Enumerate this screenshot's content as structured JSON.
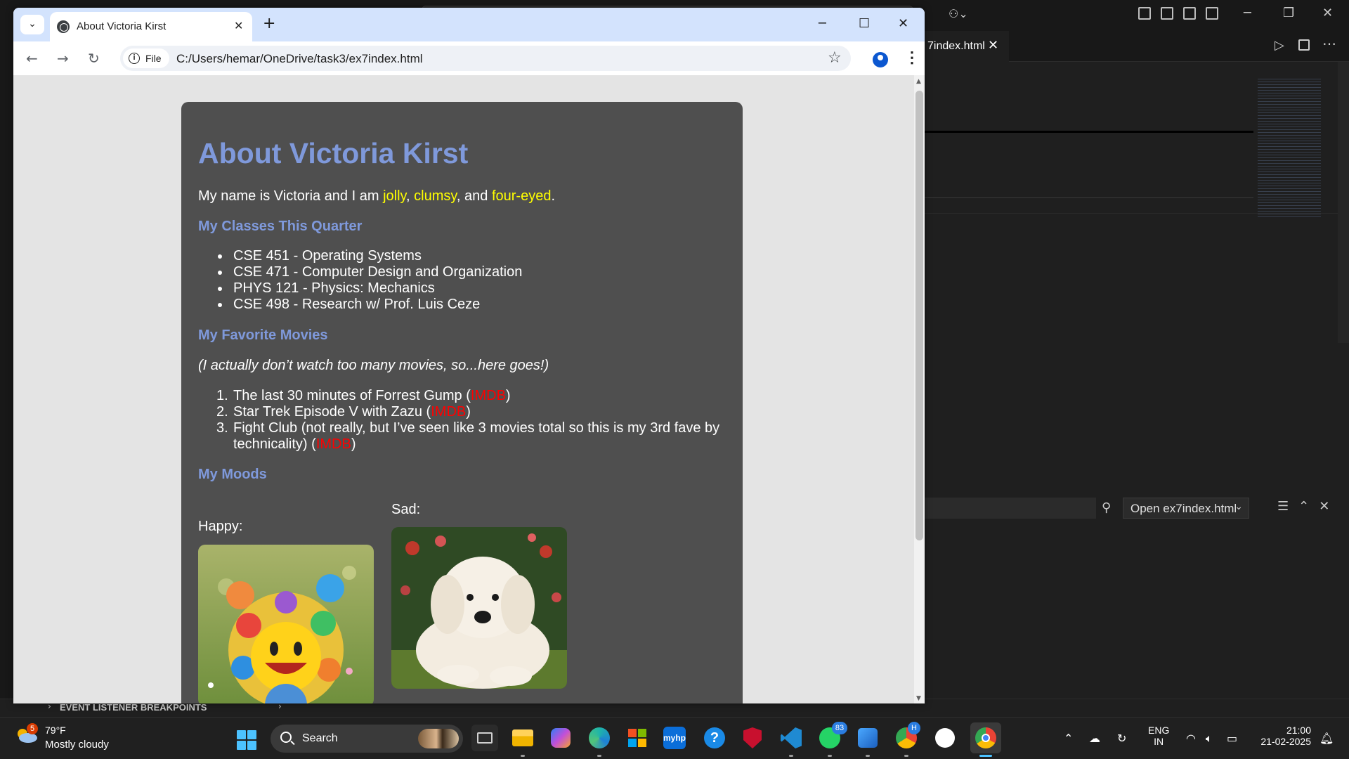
{
  "vscode": {
    "editor_tab": "7index.html",
    "find_select": "Open ex7index.html",
    "breakpoints_section": "EVENT LISTENER BREAKPOINTS"
  },
  "browser": {
    "tab_title": "About Victoria Kirst",
    "chip_label": "File",
    "url": "C:/Users/hemar/OneDrive/task3/ex7index.html"
  },
  "page": {
    "title": "About Victoria Kirst",
    "intro_prefix": "My name is Victoria and I am ",
    "trait_1": "jolly",
    "sep_1": ", ",
    "trait_2": "clumsy",
    "sep_2": ", and ",
    "trait_3": "four-eyed",
    "intro_suffix": ".",
    "classes_heading": "My Classes This Quarter",
    "classes": [
      "CSE 451 - Operating Systems",
      "CSE 471 - Computer Design and Organization",
      "PHYS 121 - Physics: Mechanics",
      "CSE 498 - Research w/ Prof. Luis Ceze"
    ],
    "movies_heading": "My Favorite Movies",
    "movies_note": "(I actually don’t watch too many movies, so...here goes!)",
    "movies": [
      {
        "num": "1.",
        "text": "The last 30 minutes of Forrest Gump (",
        "link": "IMDB",
        "end": ")"
      },
      {
        "num": "2.",
        "text": "Star Trek Episode V with Zazu (",
        "link": "IMDB",
        "end": ")"
      },
      {
        "num": "3.",
        "text": "Fight Club (not really, but I’ve seen like 3 movies total so this is my 3rd fave by technicality) (",
        "link": "IMDB",
        "end": ")"
      }
    ],
    "moods_heading": "My Moods",
    "happy_label": "Happy:",
    "sad_label": "Sad:"
  },
  "taskbar": {
    "weather_badge": "5",
    "weather_temp": "79°F",
    "weather_desc": "Mostly cloudy",
    "search_label": "Search",
    "whatsapp_badge": "83",
    "chrome_h_badge": "H",
    "lang_1": "ENG",
    "lang_2": "IN",
    "time": "21:00",
    "date": "21-02-2025",
    "myhp_label": "myhp"
  },
  "colors": {
    "heading": "#7f99db",
    "card": "#4f4f4f",
    "highlight": "#ffff00",
    "link": "#ff0000"
  }
}
